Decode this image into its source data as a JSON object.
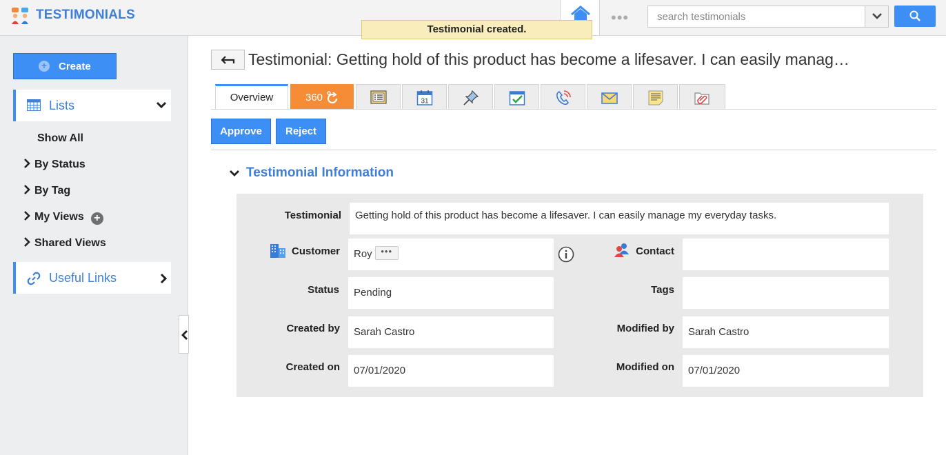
{
  "app": {
    "title": "TESTIMONIALS"
  },
  "header": {
    "search_placeholder": "search testimonials",
    "more_label": "•••"
  },
  "toast": {
    "message": "Testimonial created."
  },
  "sidebar": {
    "create_label": "Create",
    "lists_label": "Lists",
    "items": [
      {
        "label": "Show All"
      },
      {
        "label": "By Status"
      },
      {
        "label": "By Tag"
      },
      {
        "label": "My Views"
      },
      {
        "label": "Shared Views"
      }
    ],
    "useful_links_label": "Useful Links"
  },
  "main": {
    "title": "Testimonial: Getting hold of this product has become a lifesaver. I can easily manag…",
    "tabs": {
      "overview": "Overview",
      "t360": "360",
      "icons": [
        "form-icon",
        "calendar-icon",
        "pin-icon",
        "task-icon",
        "phone-icon",
        "email-icon",
        "note-icon",
        "attachment-icon"
      ],
      "calendar_day": "31"
    },
    "actions": {
      "approve": "Approve",
      "reject": "Reject"
    },
    "section_title": "Testimonial Information",
    "fields": {
      "testimonial": {
        "label": "Testimonial",
        "value": "Getting hold of this product has become a lifesaver. I can easily manage my everyday tasks."
      },
      "customer": {
        "label": "Customer",
        "value": "Roy",
        "more": "•••"
      },
      "contact": {
        "label": "Contact",
        "value": ""
      },
      "status": {
        "label": "Status",
        "value": "Pending"
      },
      "tags": {
        "label": "Tags",
        "value": ""
      },
      "created_by": {
        "label": "Created by",
        "value": "Sarah Castro"
      },
      "modified_by": {
        "label": "Modified by",
        "value": "Sarah Castro"
      },
      "created_on": {
        "label": "Created on",
        "value": "07/01/2020"
      },
      "modified_on": {
        "label": "Modified on",
        "value": "07/01/2020"
      }
    }
  },
  "colors": {
    "accent": "#3d8ef5",
    "title_blue": "#3e7fd8",
    "tab_360": "#f78c36",
    "toast_bg": "#f9eebb"
  }
}
